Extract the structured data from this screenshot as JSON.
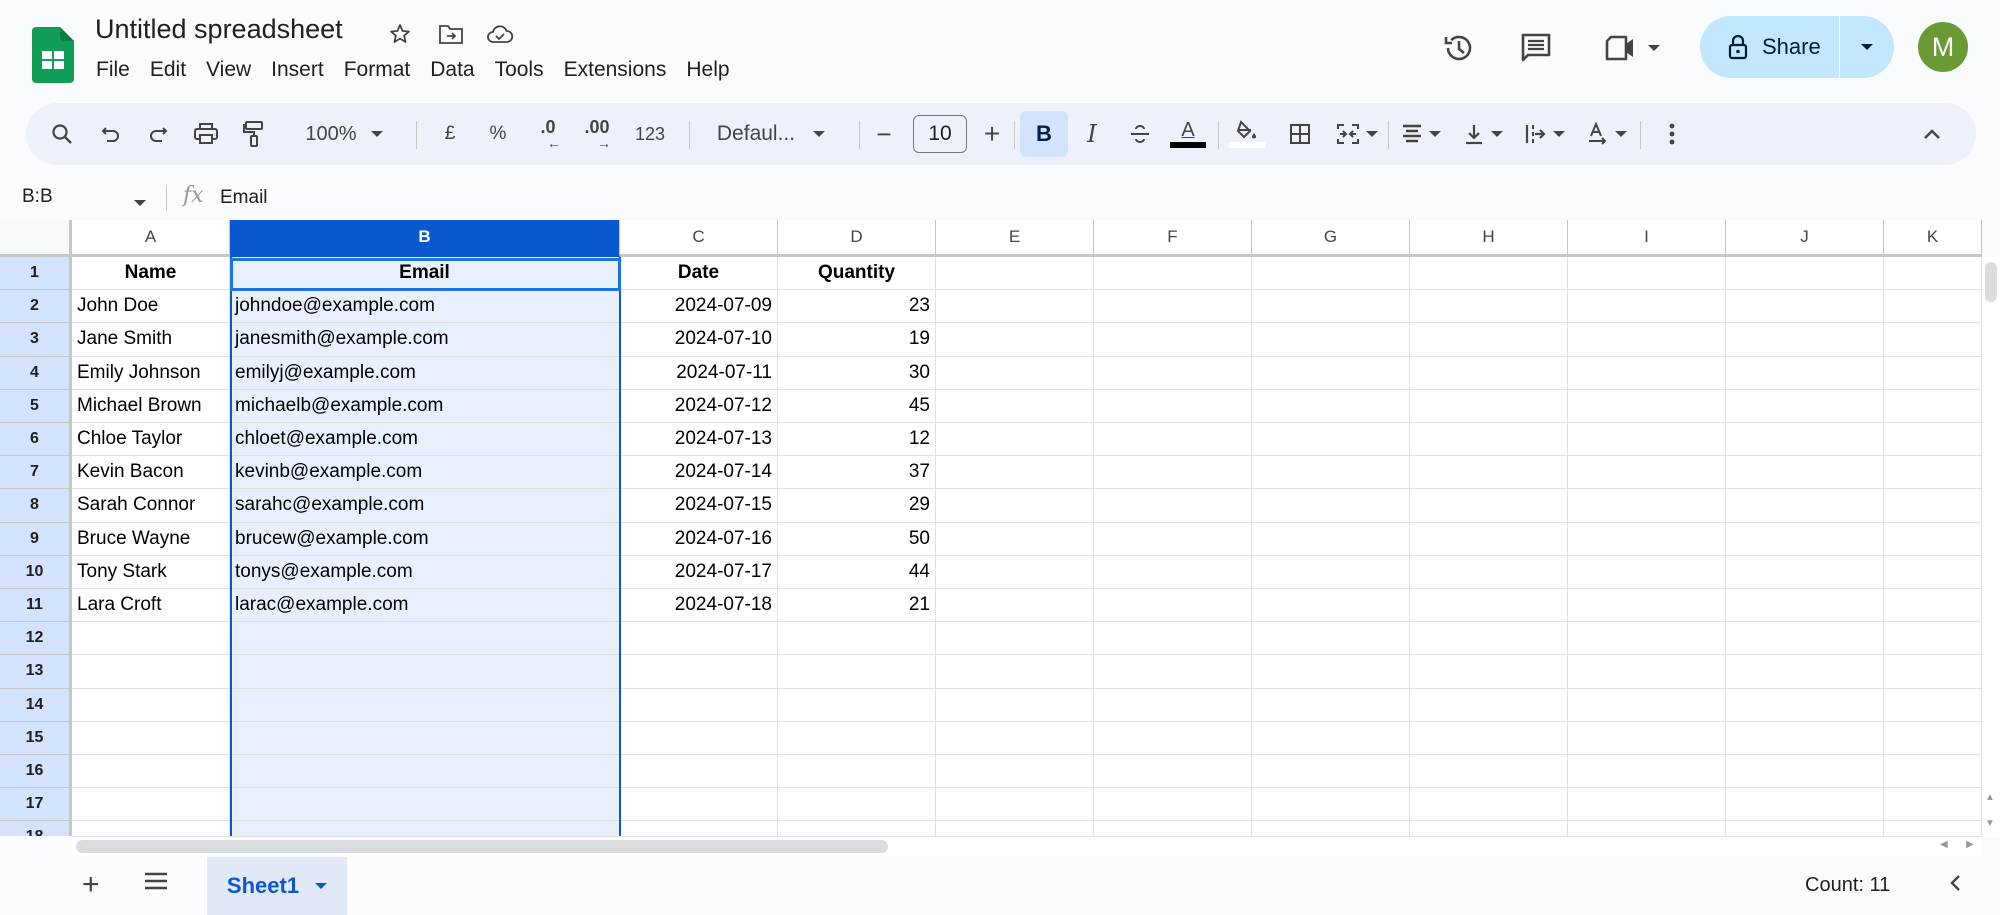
{
  "app": {
    "title": "Untitled spreadsheet",
    "brand_color": "#0f9d58",
    "accent_color": "#0b57d0",
    "title_icons": [
      "star-icon",
      "move-to-folder-icon",
      "cloud-saved-icon"
    ]
  },
  "menu": [
    "File",
    "Edit",
    "View",
    "Insert",
    "Format",
    "Data",
    "Tools",
    "Extensions",
    "Help"
  ],
  "header_right": {
    "icons": [
      "version-history-icon",
      "comments-icon",
      "meet-icon"
    ],
    "share_label": "Share",
    "avatar_initial": "M",
    "avatar_color": "#6b9a34"
  },
  "toolbar": {
    "zoom": "100%",
    "currency": "£",
    "percent": "%",
    "dec_decrease": ".0",
    "dec_increase": ".00",
    "number_format": "123",
    "font": "Defaul...",
    "font_size": "10",
    "bold": "B",
    "italic": "I",
    "text_color_letter": "A"
  },
  "formula_bar": {
    "name_box": "B:B",
    "fx": "fx",
    "value": "Email"
  },
  "grid": {
    "selected_column": "B",
    "columns": [
      "A",
      "B",
      "C",
      "D",
      "E",
      "F",
      "G",
      "H",
      "I",
      "J",
      "K"
    ],
    "rows": [
      "1",
      "2",
      "3",
      "4",
      "5",
      "6",
      "7",
      "8",
      "9",
      "10",
      "11",
      "12",
      "13",
      "14",
      "15",
      "16",
      "17",
      "18"
    ],
    "header": [
      "Name",
      "Email",
      "Date",
      "Quantity"
    ],
    "data": [
      [
        "John Doe",
        "johndoe@example.com",
        "2024-07-09",
        "23"
      ],
      [
        "Jane Smith",
        "janesmith@example.com",
        "2024-07-10",
        "19"
      ],
      [
        "Emily Johnson",
        "emilyj@example.com",
        "2024-07-11",
        "30"
      ],
      [
        "Michael Brown",
        "michaelb@example.com",
        "2024-07-12",
        "45"
      ],
      [
        "Chloe Taylor",
        "chloet@example.com",
        "2024-07-13",
        "12"
      ],
      [
        "Kevin Bacon",
        "kevinb@example.com",
        "2024-07-14",
        "37"
      ],
      [
        "Sarah Connor",
        "sarahc@example.com",
        "2024-07-15",
        "29"
      ],
      [
        "Bruce Wayne",
        "brucew@example.com",
        "2024-07-16",
        "50"
      ],
      [
        "Tony Stark",
        "tonys@example.com",
        "2024-07-17",
        "44"
      ],
      [
        "Lara Croft",
        "larac@example.com",
        "2024-07-18",
        "21"
      ]
    ]
  },
  "bottom": {
    "sheet_tab": "Sheet1",
    "status": "Count: 11"
  }
}
